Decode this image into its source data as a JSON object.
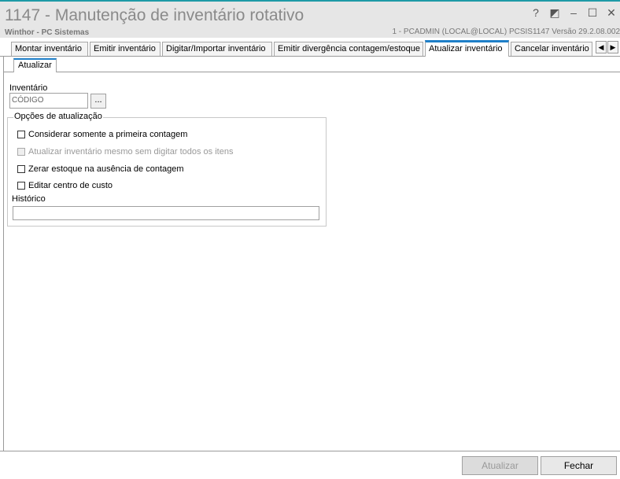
{
  "window": {
    "title": "1147 - Manutenção de inventário rotativo",
    "subtitle": "Winthor - PC Sistemas",
    "info": "1 - PCADMIN (LOCAL@LOCAL)   PCSIS1147  Versão  29.2.08.002",
    "buttons": {
      "help": "?",
      "restore": "◩",
      "minimize": "–",
      "maximize": "☐",
      "close": "✕"
    }
  },
  "tabs": [
    {
      "label": "Montar inventário"
    },
    {
      "label": "Emitir inventário"
    },
    {
      "label": "Digitar/Importar inventário"
    },
    {
      "label": "Emitir divergência contagem/estoque"
    },
    {
      "label": "Atualizar inventário"
    },
    {
      "label": "Cancelar inventário"
    }
  ],
  "active_tab": "Atualizar inventário",
  "scroll_buttons": {
    "left": "◀",
    "right": "▶"
  },
  "subtab": {
    "label": "Atualizar"
  },
  "form": {
    "inventario_label": "Inventário",
    "inventario_placeholder": "CÓDIGO",
    "lookup_button": "...",
    "options_title": "Opções de atualização",
    "options": [
      {
        "label": "Considerar somente a primeira contagem",
        "checked": false,
        "enabled": true
      },
      {
        "label": "Atualizar inventário mesmo sem digitar todos os itens",
        "checked": false,
        "enabled": false
      },
      {
        "label": "Zerar estoque na ausência de contagem",
        "checked": false,
        "enabled": true
      },
      {
        "label": "Editar centro de custo",
        "checked": false,
        "enabled": true
      }
    ],
    "historico_label": "Histórico",
    "historico_value": ""
  },
  "footer": {
    "atualizar_label": "Atualizar",
    "fechar_label": "Fechar"
  },
  "colors": {
    "accent": "#1e7fc8",
    "titlebar_bg": "#e6e6e6",
    "disabled_button_bg": "#dcdcdc"
  }
}
